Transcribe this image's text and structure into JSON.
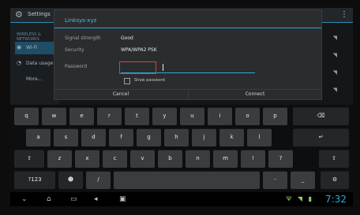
{
  "settings_app": {
    "title": "Settings",
    "left_pane": {
      "header": "WIRELESS & NETWORKS",
      "items": [
        {
          "label": "Wi-Fi",
          "icon": "wifi-icon"
        },
        {
          "label": "Data usage",
          "icon": "data-usage-icon"
        },
        {
          "label": "More...",
          "icon": ""
        }
      ]
    }
  },
  "dialog": {
    "title": "Linksys-xyz",
    "rows": [
      {
        "label": "Signal strength",
        "value": "Good"
      },
      {
        "label": "Security",
        "value": "WPA/WPA2 PSK"
      },
      {
        "label": "Password",
        "value": ""
      }
    ],
    "show_password_label": "Show password",
    "cancel_label": "Cancel",
    "connect_label": "Connect"
  },
  "keyboard": {
    "row1": [
      "q",
      "w",
      "e",
      "r",
      "t",
      "y",
      "u",
      "i",
      "o",
      "p",
      "⌫"
    ],
    "row2": [
      "a",
      "s",
      "d",
      "f",
      "g",
      "h",
      "j",
      "k",
      "l",
      "↵"
    ],
    "row3": [
      "⇧",
      "z",
      "x",
      "c",
      "v",
      "b",
      "n",
      "m",
      "!",
      "?",
      "⇧"
    ],
    "row4": [
      "?123",
      "☻",
      "/",
      "",
      "-",
      "_",
      "⚙"
    ]
  },
  "navbar": {
    "clock": "7:32",
    "icons": [
      "back-icon",
      "home-icon",
      "recent-apps-icon",
      "screenshot-icon"
    ]
  }
}
